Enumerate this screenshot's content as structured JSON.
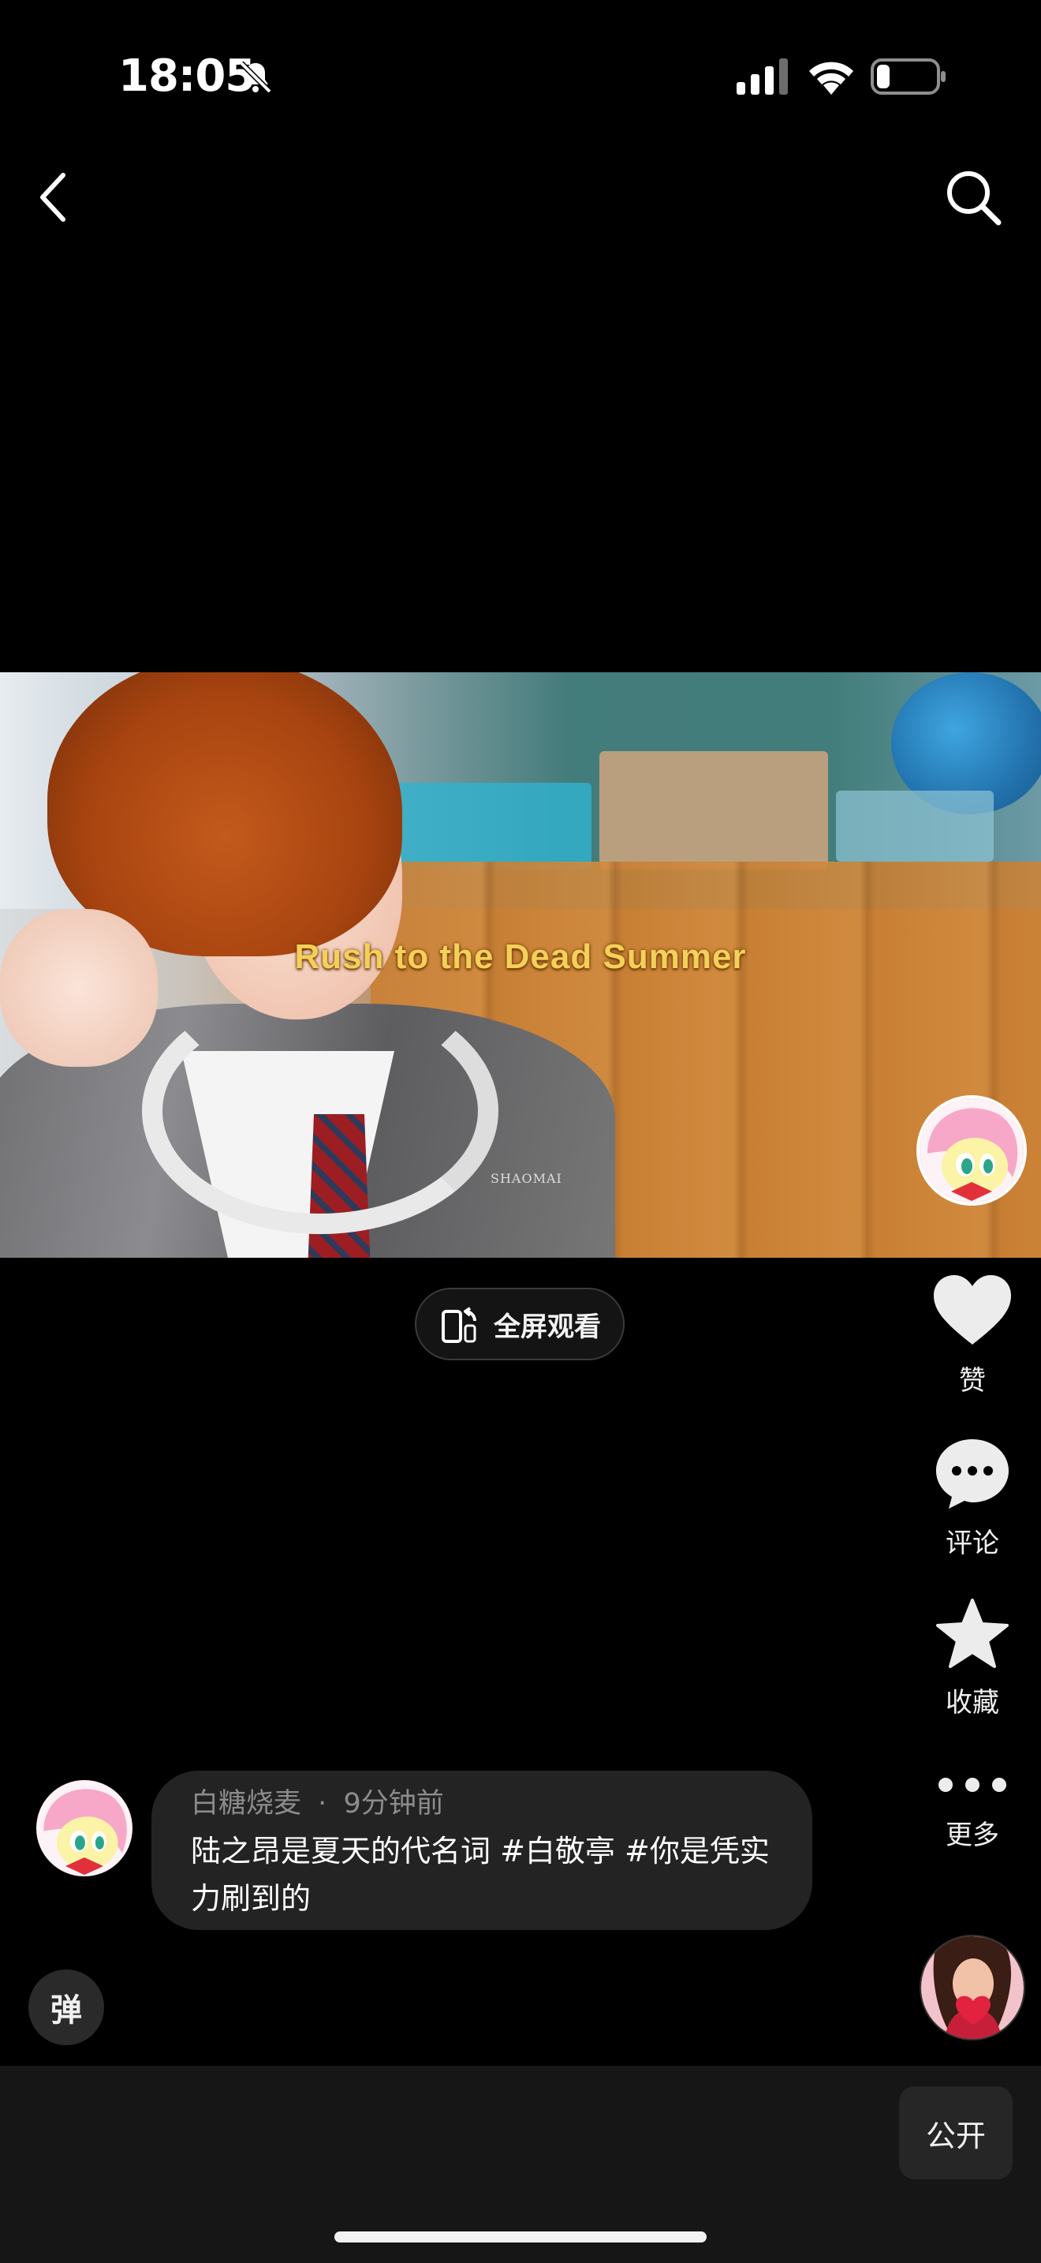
{
  "status_bar": {
    "time": "18:05",
    "icons": [
      "bell-slash-icon",
      "signal-icon",
      "wifi-icon",
      "battery-icon"
    ],
    "battery_level": 0.2
  },
  "nav": {
    "back_icon": "chevron-left-icon",
    "search_icon": "search-icon"
  },
  "video": {
    "caption": "Rush to the Dead Summer",
    "watermark": "SHAOMAI"
  },
  "fullscreen": {
    "label": "全屏观看",
    "icon": "rotate-phone-icon"
  },
  "rail": {
    "like_label": "赞",
    "comment_label": "评论",
    "favorite_label": "收藏",
    "more_label": "更多"
  },
  "comment": {
    "author": "白糖烧麦",
    "time": "9分钟前",
    "separator": "·",
    "text": "陆之昂是夏天的代名词 #白敬亭 #你是凭实力刷到的"
  },
  "danmaku": {
    "label": "弹"
  },
  "bottom_bar": {
    "public_label": "公开"
  },
  "colors": {
    "background": "#000000",
    "bubble": "#232323",
    "caption": "#f4d05a"
  }
}
